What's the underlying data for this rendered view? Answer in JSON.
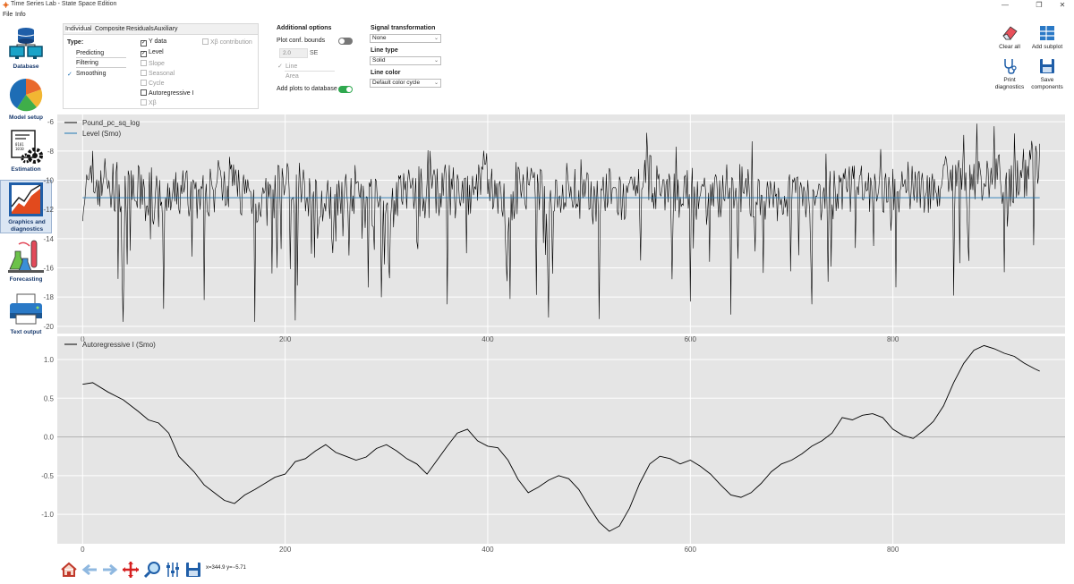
{
  "window": {
    "title": "Time Series Lab - State Space Edition",
    "controls": [
      "—",
      "❐",
      "✕"
    ]
  },
  "menu": [
    "File",
    "Info"
  ],
  "sidebar": [
    {
      "label": "Database",
      "icon": "database-icon"
    },
    {
      "label": "Model setup",
      "icon": "pie-chart-icon"
    },
    {
      "label": "Estimation",
      "icon": "gears-icon"
    },
    {
      "label": "Graphics and diagnostics",
      "icon": "chart-icon",
      "selected": true
    },
    {
      "label": "Forecasting",
      "icon": "flask-icon"
    },
    {
      "label": "Text output",
      "icon": "printer-icon"
    }
  ],
  "panel": {
    "tabs": [
      "Individual",
      "Composite",
      "Residuals",
      "Auxiliary"
    ],
    "active_tab": "Individual",
    "type_label": "Type:",
    "types": [
      {
        "label": "Predicting",
        "checked": false
      },
      {
        "label": "Filtering",
        "checked": false
      },
      {
        "label": "Smoothing",
        "checked": true
      }
    ],
    "components": [
      {
        "label": "Y data",
        "checked": true,
        "enabled": true
      },
      {
        "label": "Level",
        "checked": true,
        "enabled": true
      },
      {
        "label": "Slope",
        "checked": false,
        "enabled": false
      },
      {
        "label": "Seasonal",
        "checked": false,
        "enabled": false
      },
      {
        "label": "Cycle",
        "checked": false,
        "enabled": false
      },
      {
        "label": "Autoregressive I",
        "checked": false,
        "enabled": true
      },
      {
        "label": "Xβ",
        "checked": false,
        "enabled": false
      }
    ],
    "xb_contribution": "Xβ contribution"
  },
  "additional": {
    "title": "Additional options",
    "conf_label": "Plot conf. bounds",
    "conf_on": false,
    "se_value": "2.0",
    "se_label": "SE",
    "style_options": [
      "Line",
      "Area"
    ],
    "add_db_label": "Add plots to database",
    "add_db_on": true
  },
  "signal": {
    "title": "Signal transformation",
    "value": "None",
    "line_type_label": "Line type",
    "line_type_value": "Solid",
    "line_color_label": "Line color",
    "line_color_value": "Default color cycle"
  },
  "toolbar_right": [
    {
      "label": "Clear all",
      "icon": "eraser-icon"
    },
    {
      "label": "Add subplot",
      "icon": "grid-icon"
    },
    {
      "label": "Print diagnostics",
      "icon": "stethoscope-icon"
    },
    {
      "label": "Save components",
      "icon": "save-icon"
    }
  ],
  "bottom_toolbar": {
    "icons": [
      "home-icon",
      "back-arrow-icon",
      "forward-arrow-icon",
      "pan-icon",
      "zoom-icon",
      "configure-icon",
      "save-figure-icon"
    ],
    "coords": "x=344.9 y=−5.71"
  },
  "colors": {
    "accent": "#1f6fb5",
    "toggle_on": "#2fa84f",
    "series_black": "#000000",
    "series_level": "#1f77b4"
  },
  "chart_data": [
    {
      "type": "line",
      "title": "",
      "xlabel": "",
      "ylabel": "",
      "xlim": [
        -25,
        970
      ],
      "ylim": [
        -20.5,
        -5.5
      ],
      "xticks": [
        0,
        200,
        400,
        600,
        800
      ],
      "yticks": [
        -6,
        -8,
        -10,
        -12,
        -14,
        -16,
        -18,
        -20
      ],
      "grid": true,
      "legend_position": "top-left",
      "series": [
        {
          "name": "Pound_pc_sq_log",
          "color": "#000000",
          "kind": "noisy",
          "x": [
            0,
            20,
            40,
            60,
            80,
            100,
            120,
            140,
            160,
            180,
            200,
            220,
            240,
            260,
            280,
            300,
            320,
            340,
            360,
            380,
            400,
            420,
            440,
            460,
            480,
            500,
            520,
            540,
            560,
            580,
            600,
            620,
            640,
            660,
            680,
            700,
            720,
            740,
            760,
            780,
            800,
            820,
            840,
            860,
            880,
            900,
            920,
            945
          ],
          "y": [
            -11.0,
            -9.8,
            -11.5,
            -10.5,
            -12.0,
            -10.6,
            -11.2,
            -9.9,
            -10.8,
            -11.6,
            -10.2,
            -10.9,
            -11.8,
            -10.3,
            -11.1,
            -12.2,
            -10.5,
            -11.0,
            -10.6,
            -11.4,
            -10.1,
            -11.9,
            -10.7,
            -11.2,
            -10.4,
            -11.3,
            -10.9,
            -11.6,
            -10.0,
            -11.2,
            -10.8,
            -11.5,
            -10.3,
            -11.0,
            -11.7,
            -10.6,
            -10.9,
            -11.2,
            -10.5,
            -10.8,
            -11.0,
            -10.2,
            -10.7,
            -10.4,
            -9.9,
            -9.8,
            -10.3,
            -8.4
          ],
          "min_extremes": [
            [
              40,
              -19.7
            ],
            [
              80,
              -18.8
            ],
            [
              120,
              -18.2
            ],
            [
              170,
              -19.7
            ],
            [
              210,
              -19.6
            ],
            [
              360,
              -18.5
            ],
            [
              460,
              -19.4
            ],
            [
              510,
              -19.5
            ],
            [
              600,
              -18.3
            ],
            [
              640,
              -19.2
            ],
            [
              720,
              -18.5
            ],
            [
              860,
              -17.9
            ],
            [
              910,
              -16.3
            ]
          ],
          "max_extremes": [
            [
              10,
              -8.0
            ],
            [
              560,
              -8.3
            ],
            [
              870,
              -6.9
            ],
            [
              900,
              -6.3
            ],
            [
              920,
              -6.8
            ],
            [
              945,
              -7.5
            ]
          ]
        },
        {
          "name": "Level (Smo)",
          "color": "#1f77b4",
          "x": [
            0,
            945
          ],
          "y": [
            -11.2,
            -11.2
          ]
        }
      ]
    },
    {
      "type": "line",
      "title": "",
      "xlabel": "",
      "ylabel": "",
      "xlim": [
        -25,
        970
      ],
      "ylim": [
        -1.38,
        1.3
      ],
      "xticks": [
        0,
        200,
        400,
        600,
        800
      ],
      "yticks": [
        1.0,
        0.5,
        0.0,
        -0.5,
        -1.0
      ],
      "grid": true,
      "legend_position": "top-left",
      "zero_line": true,
      "series": [
        {
          "name": "Autoregressive I (Smo)",
          "color": "#000000",
          "x": [
            0,
            10,
            25,
            40,
            55,
            65,
            75,
            85,
            95,
            110,
            120,
            130,
            140,
            150,
            160,
            170,
            180,
            190,
            200,
            210,
            220,
            230,
            240,
            250,
            260,
            270,
            280,
            290,
            300,
            310,
            320,
            330,
            340,
            350,
            360,
            370,
            380,
            390,
            400,
            410,
            420,
            430,
            440,
            450,
            460,
            470,
            480,
            490,
            500,
            510,
            520,
            530,
            540,
            550,
            560,
            570,
            580,
            590,
            600,
            610,
            620,
            630,
            640,
            650,
            660,
            670,
            680,
            690,
            700,
            710,
            720,
            730,
            740,
            750,
            760,
            770,
            780,
            790,
            800,
            810,
            820,
            830,
            840,
            850,
            860,
            870,
            880,
            890,
            900,
            910,
            920,
            930,
            940,
            945
          ],
          "y": [
            0.68,
            0.7,
            0.58,
            0.48,
            0.33,
            0.22,
            0.18,
            0.05,
            -0.25,
            -0.45,
            -0.62,
            -0.72,
            -0.82,
            -0.86,
            -0.75,
            -0.68,
            -0.6,
            -0.52,
            -0.48,
            -0.32,
            -0.28,
            -0.18,
            -0.1,
            -0.2,
            -0.25,
            -0.3,
            -0.26,
            -0.15,
            -0.1,
            -0.18,
            -0.28,
            -0.35,
            -0.48,
            -0.3,
            -0.12,
            0.05,
            0.1,
            -0.05,
            -0.12,
            -0.14,
            -0.3,
            -0.55,
            -0.72,
            -0.65,
            -0.56,
            -0.5,
            -0.54,
            -0.68,
            -0.9,
            -1.1,
            -1.22,
            -1.15,
            -0.92,
            -0.6,
            -0.35,
            -0.25,
            -0.28,
            -0.35,
            -0.3,
            -0.38,
            -0.48,
            -0.62,
            -0.75,
            -0.78,
            -0.72,
            -0.6,
            -0.45,
            -0.35,
            -0.3,
            -0.22,
            -0.12,
            -0.05,
            0.05,
            0.25,
            0.22,
            0.28,
            0.3,
            0.25,
            0.1,
            0.02,
            -0.02,
            0.08,
            0.2,
            0.4,
            0.7,
            0.95,
            1.12,
            1.18,
            1.14,
            1.08,
            1.04,
            0.95,
            0.88,
            0.85
          ]
        }
      ]
    }
  ]
}
